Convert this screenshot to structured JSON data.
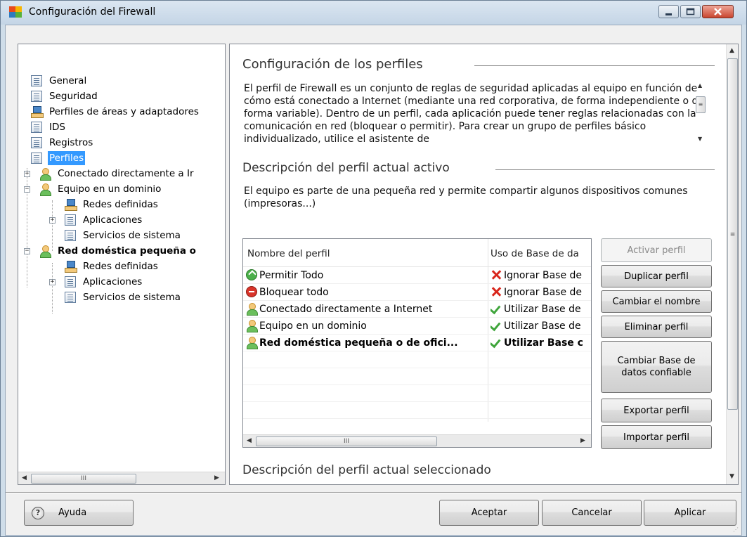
{
  "window": {
    "title": "Configuración del Firewall"
  },
  "tree": {
    "items": [
      {
        "label": "General"
      },
      {
        "label": "Seguridad"
      },
      {
        "label": "Perfiles de áreas y adaptadores"
      },
      {
        "label": "IDS"
      },
      {
        "label": "Registros"
      },
      {
        "label": "Perfiles"
      },
      {
        "label": "Conectado directamente a Ir"
      },
      {
        "label": "Equipo en un dominio"
      },
      {
        "label": "Redes definidas"
      },
      {
        "label": "Aplicaciones"
      },
      {
        "label": "Servicios de sistema"
      },
      {
        "label": "Red doméstica pequeña o"
      },
      {
        "label": "Redes definidas"
      },
      {
        "label": "Aplicaciones"
      },
      {
        "label": "Servicios de sistema"
      }
    ],
    "scroll_grip": "III"
  },
  "main": {
    "profiles_title": "Configuración de los perfiles",
    "profiles_description": "El perfil de Firewall es un conjunto de reglas de seguridad aplicadas al equipo en función de cómo está conectado a Internet (mediante una red corporativa, de forma independiente o de forma variable). Dentro de un perfil, cada aplicación puede tener reglas relacionadas con la comunicación en red (bloquear o permitir). Para crear un grupo de perfiles básico individualizado, utilice el asistente de",
    "active_title": "Descripción del perfil actual activo",
    "active_description": "El equipo es parte de una pequeña red y permite compartir algunos dispositivos comunes (impresoras...)",
    "selected_title": "Descripción del perfil actual seleccionado",
    "list": {
      "columns": [
        "Nombre del perfil",
        "Uso de Base de da"
      ],
      "rows": [
        {
          "name": "Permitir Todo",
          "usage": "Ignorar Base de",
          "name_icon": "allow-icon",
          "usage_icon": "cross-icon",
          "bold": false
        },
        {
          "name": "Bloquear todo",
          "usage": "Ignorar Base de",
          "name_icon": "block-icon",
          "usage_icon": "cross-icon",
          "bold": false
        },
        {
          "name": "Conectado directamente a Internet",
          "usage": "Utilizar Base de",
          "name_icon": "user-icon",
          "usage_icon": "check-icon",
          "bold": false
        },
        {
          "name": "Equipo en un dominio",
          "usage": "Utilizar Base de",
          "name_icon": "user-icon",
          "usage_icon": "check-icon",
          "bold": false
        },
        {
          "name": "Red doméstica pequeña o de ofici...",
          "usage": "Utilizar Base c",
          "name_icon": "user-icon",
          "usage_icon": "check-icon",
          "bold": true
        }
      ],
      "scroll_grip": "III"
    },
    "buttons": {
      "activate": "Activar perfil",
      "duplicate": "Duplicar perfil",
      "rename": "Cambiar el nombre",
      "delete": "Eliminar perfil",
      "change_trusted_db": "Cambiar Base de datos confiable",
      "export": "Exportar perfil",
      "import": "Importar perfil"
    }
  },
  "footer": {
    "help": "Ayuda",
    "accept": "Aceptar",
    "cancel": "Cancelar",
    "apply": "Aplicar"
  },
  "colors": {
    "selection": "#3399ff",
    "window_frame": "#cfdde9"
  }
}
